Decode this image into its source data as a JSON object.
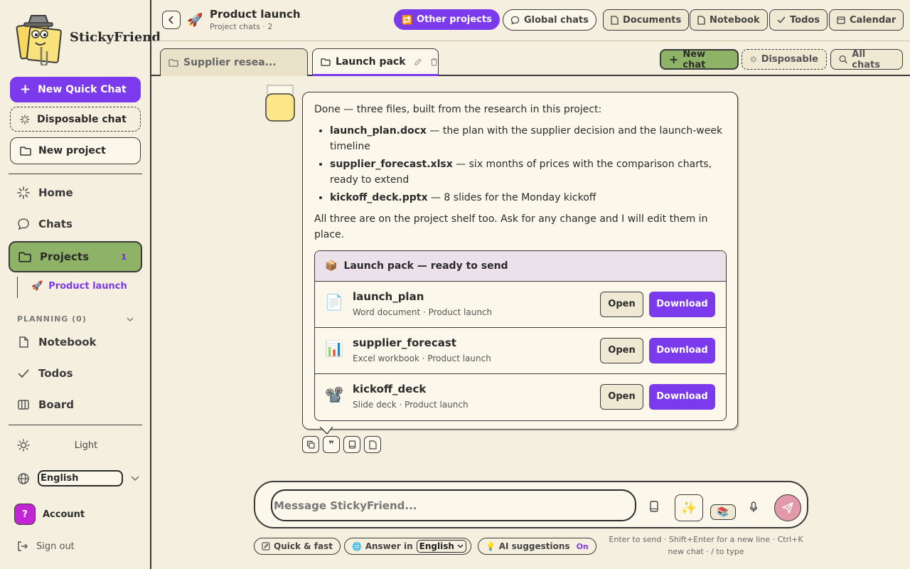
{
  "brand": {
    "name": "StickyFriend"
  },
  "sidebar": {
    "new_quick_chat": "New Quick Chat",
    "disposable_chat": "Disposable chat",
    "new_project": "New project",
    "nav": {
      "home": "Home",
      "chats": "Chats",
      "projects": "Projects",
      "projects_badge": "1"
    },
    "sub_project": "Product launch",
    "planning_label": "PLANNING (0)",
    "planning_items": {
      "notebook": "Notebook",
      "todos": "Todos",
      "board": "Board"
    },
    "theme_label": "Light",
    "language_value": "English",
    "account_label": "Account",
    "account_initial": "?",
    "sign_out": "Sign out"
  },
  "header": {
    "title": "Product launch",
    "subtitle": "Project chats · 2",
    "other_projects": "Other projects",
    "global_chats": "Global chats",
    "documents": "Documents",
    "notebook": "Notebook",
    "todos": "Todos",
    "calendar": "Calendar"
  },
  "tabs": {
    "tab1": "Supplier resea...",
    "tab2": "Launch pack",
    "new_chat": "New chat",
    "disposable": "Disposable",
    "all_chats": "All chats"
  },
  "message": {
    "intro": "Done — three files, built from the research in this project:",
    "items": [
      {
        "file": "launch_plan.docx",
        "desc": " — the plan with the supplier decision and the launch-week timeline"
      },
      {
        "file": "supplier_forecast.xlsx",
        "desc": " — six months of prices with the comparison charts, ready to extend"
      },
      {
        "file": "kickoff_deck.pptx",
        "desc": " — 8 slides for the Monday kickoff"
      }
    ],
    "outro": "All three are on the project shelf too. Ask for any change and I will edit them in place.",
    "pack_title": "Launch pack — ready to send",
    "files": [
      {
        "name": "launch_plan",
        "meta": "Word document · Product launch",
        "icon": "📄"
      },
      {
        "name": "supplier_forecast",
        "meta": "Excel workbook · Product launch",
        "icon": "📊"
      },
      {
        "name": "kickoff_deck",
        "meta": "Slide deck · Product launch",
        "icon": "📽️"
      }
    ],
    "open_label": "Open",
    "download_label": "Download"
  },
  "composer": {
    "placeholder": "Message StickyFriend...",
    "quick_fast": "Quick & fast",
    "answer_in": "Answer in",
    "answer_lang": "English",
    "ai_suggestions": "AI suggestions",
    "ai_state": "On",
    "hint": "Enter to send · Shift+Enter for a new line · Ctrl+K new chat · / to type"
  },
  "colors": {
    "accent": "#7c3aed",
    "projects_green": "#8fb366",
    "background": "#f4efdf"
  }
}
